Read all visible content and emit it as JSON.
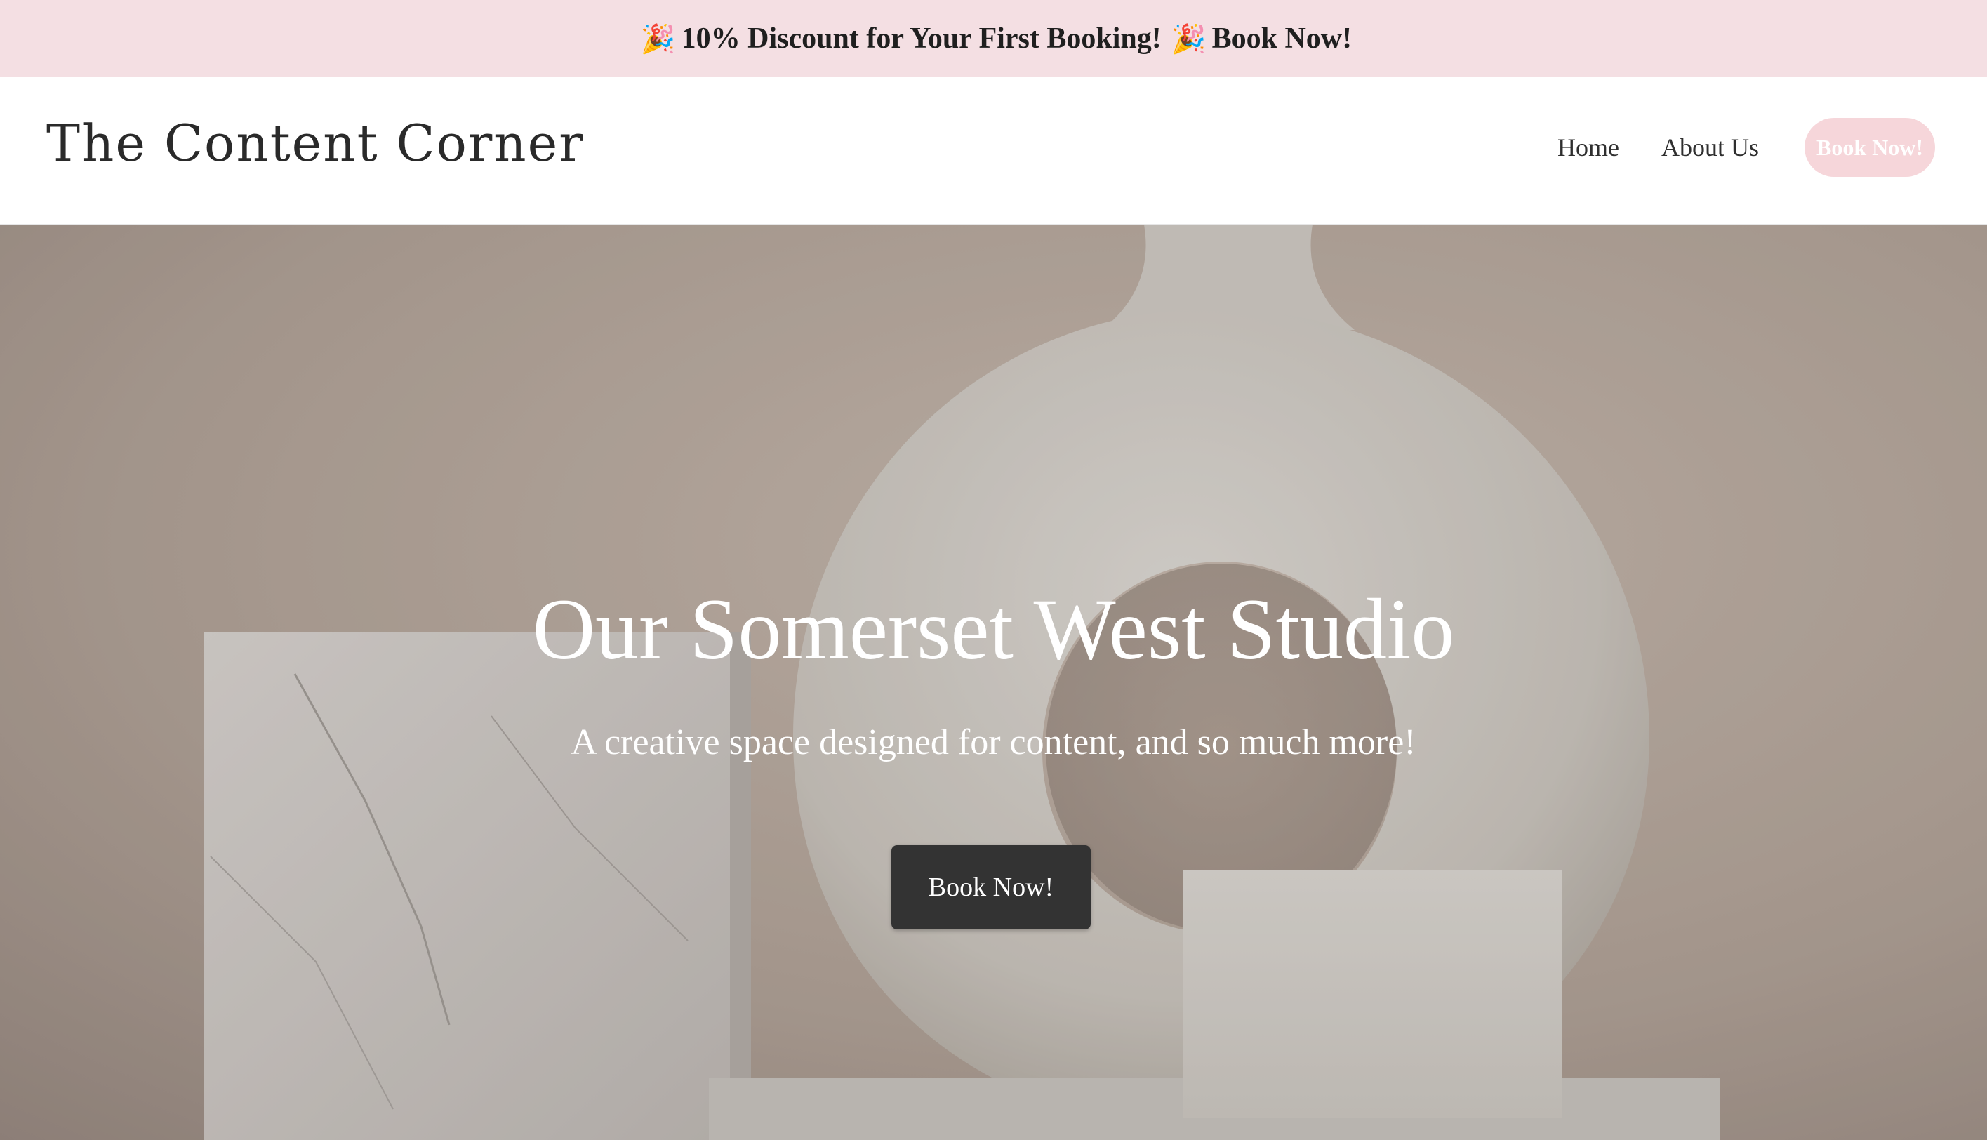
{
  "announcement": {
    "icon": "party-popper-icon",
    "text": "10% Discount for Your First Booking!",
    "cta": "Book Now!"
  },
  "header": {
    "logo": "The Content Corner",
    "nav": [
      {
        "label": "Home"
      },
      {
        "label": "About Us"
      }
    ],
    "cta_label": "Book Now!"
  },
  "hero": {
    "title": "Our Somerset West Studio",
    "subtitle": "A creative space designed for content, and so much more!",
    "cta_label": "Book Now!"
  },
  "colors": {
    "announcement_bg": "#f4dfe3",
    "nav_cta_bg": "#f6d6da",
    "hero_cta_bg": "#333333",
    "text_dark": "#2a2a2a"
  }
}
